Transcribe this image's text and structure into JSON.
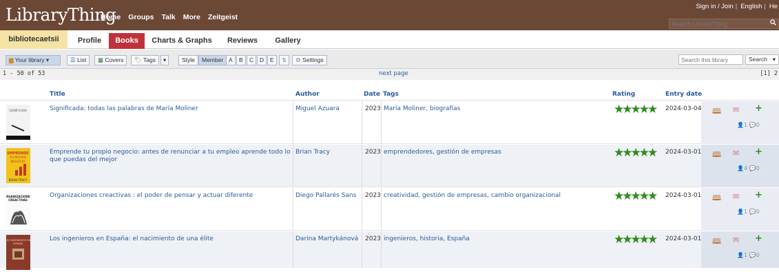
{
  "site": {
    "logo": "LibraryThing",
    "nav": [
      "Home",
      "Groups",
      "Talk",
      "More",
      "Zeitgeist"
    ],
    "signin": "Sign in / Join",
    "language": "English",
    "help": "He",
    "search_placeholder": "Search LibraryThing"
  },
  "tabs": {
    "user": "bibliotecaetsii",
    "items": [
      "Profile",
      "Books",
      "Charts & Graphs",
      "Reviews",
      "Gallery"
    ],
    "active": "Books"
  },
  "toolbar": {
    "your_library": "Your library",
    "list": "List",
    "covers": "Covers",
    "tags": "Tags",
    "style": "Style",
    "member": "Member",
    "letters": [
      "A",
      "B",
      "C",
      "D",
      "E"
    ],
    "settings": "Settings",
    "search_placeholder": "Search this library",
    "search_button": "Search"
  },
  "pagination": {
    "count": "1 - 50 of 53",
    "next": "next page",
    "pages": "[1] 2"
  },
  "columns": {
    "title": "Title",
    "author": "Author",
    "date": "Date",
    "tags": "Tags",
    "rating": "Rating",
    "entry_date": "Entry date"
  },
  "books": [
    {
      "title": "Significada: todas las palabras de María Moliner",
      "author": "Miguel Azuara",
      "date": "2023",
      "tags": "María Moliner, biografías",
      "rating": 5,
      "entry_date": "2024-03-04",
      "members": "1",
      "comments": "0"
    },
    {
      "title": "Emprende tu propio negocio: antes de renunciar a tu empleo aprende todo lo que puedas del mejor",
      "author": "Brian Tracy",
      "date": "2023",
      "tags": "emprendedores, gestión de empresas",
      "rating": 5,
      "entry_date": "2024-03-01",
      "members": "4",
      "comments": "0"
    },
    {
      "title": "Organizaciones creactivas : el poder de pensar y actuar diferente",
      "author": "Diego Pallarés Sans",
      "date": "2023",
      "tags": "creatividad, gestión de empresas, cambio organizacional",
      "rating": 5,
      "entry_date": "2024-03-01",
      "members": "1",
      "comments": "0"
    },
    {
      "title": "Los ingenieros en España: el nacimiento de una élite",
      "author": "Darina Martykánová",
      "date": "2023",
      "tags": "ingenieros, historia, España",
      "rating": 5,
      "entry_date": "2024-03-01",
      "members": "1",
      "comments": "0"
    }
  ],
  "colors": {
    "header": "#6b4736",
    "active_tab": "#c0323b",
    "user_tab": "#f4e3a4",
    "link": "#2a5a9a",
    "stars": "#2e8b1e"
  },
  "icons": [
    "book-icon",
    "review-icon",
    "add-icon",
    "member-icon",
    "comment-icon"
  ]
}
